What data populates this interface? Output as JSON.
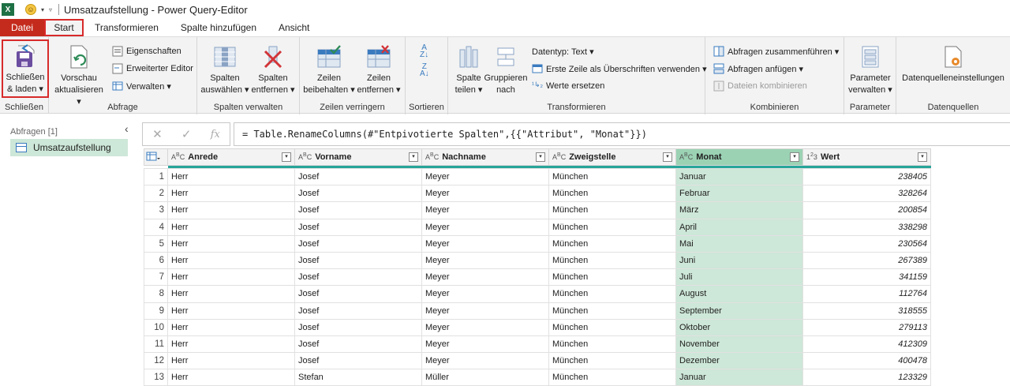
{
  "title": {
    "app_icon": "X",
    "text": "Umsatzaufstellung - Power Query-Editor"
  },
  "tabs": [
    "Datei",
    "Start",
    "Transformieren",
    "Spalte hinzufügen",
    "Ansicht"
  ],
  "ribbon": {
    "schliessen": {
      "btn1": "Schließen",
      "btn2": "& laden",
      "group": "Schließen"
    },
    "abfrage": {
      "vorschau1": "Vorschau",
      "vorschau2": "aktualisieren",
      "eigenschaften": "Eigenschaften",
      "editor": "Erweiterter Editor",
      "verwalten": "Verwalten",
      "group": "Abfrage"
    },
    "spalten": {
      "a1": "Spalten",
      "a2": "auswählen",
      "b1": "Spalten",
      "b2": "entfernen",
      "group": "Spalten verwalten"
    },
    "zeilen": {
      "a1": "Zeilen",
      "a2": "beibehalten",
      "b1": "Zeilen",
      "b2": "entfernen",
      "group": "Zeilen verringern"
    },
    "sortieren": {
      "group": "Sortieren"
    },
    "transformieren": {
      "teilen1": "Spalte",
      "teilen2": "teilen",
      "gruppieren1": "Gruppieren",
      "gruppieren2": "nach",
      "datentyp": "Datentyp: Text",
      "erste_zeile": "Erste Zeile als Überschriften verwenden",
      "werte": "Werte ersetzen",
      "group": "Transformieren"
    },
    "kombinieren": {
      "zusammen": "Abfragen zusammenführen",
      "anfuegen": "Abfragen anfügen",
      "dateien": "Dateien kombinieren",
      "group": "Kombinieren"
    },
    "parameter": {
      "p1": "Parameter",
      "p2": "verwalten",
      "group": "Parameter"
    },
    "datenquellen": {
      "btn": "Datenquelleneinstellungen",
      "group": "Datenquellen"
    }
  },
  "queries": {
    "label": "Abfragen [1]",
    "items": [
      "Umsatzaufstellung"
    ]
  },
  "formula_bar": {
    "cancel": "✕",
    "confirm": "✓",
    "fx": "fx",
    "text": "= Table.RenameColumns(#\"Entpivotierte Spalten\",{{\"Attribut\", \"Monat\"}})"
  },
  "grid": {
    "columns": [
      {
        "type": "ABC",
        "name": "Anrede"
      },
      {
        "type": "ABC",
        "name": "Vorname"
      },
      {
        "type": "ABC",
        "name": "Nachname"
      },
      {
        "type": "ABC",
        "name": "Zweigstelle"
      },
      {
        "type": "ABC",
        "name": "Monat"
      },
      {
        "type": "123",
        "name": "Wert"
      }
    ],
    "rows": [
      [
        "1",
        "Herr",
        "Josef",
        "Meyer",
        "München",
        "Januar",
        "238405"
      ],
      [
        "2",
        "Herr",
        "Josef",
        "Meyer",
        "München",
        "Februar",
        "328264"
      ],
      [
        "3",
        "Herr",
        "Josef",
        "Meyer",
        "München",
        "März",
        "200854"
      ],
      [
        "4",
        "Herr",
        "Josef",
        "Meyer",
        "München",
        "April",
        "338298"
      ],
      [
        "5",
        "Herr",
        "Josef",
        "Meyer",
        "München",
        "Mai",
        "230564"
      ],
      [
        "6",
        "Herr",
        "Josef",
        "Meyer",
        "München",
        "Juni",
        "267389"
      ],
      [
        "7",
        "Herr",
        "Josef",
        "Meyer",
        "München",
        "Juli",
        "341159"
      ],
      [
        "8",
        "Herr",
        "Josef",
        "Meyer",
        "München",
        "August",
        "112764"
      ],
      [
        "9",
        "Herr",
        "Josef",
        "Meyer",
        "München",
        "September",
        "318555"
      ],
      [
        "10",
        "Herr",
        "Josef",
        "Meyer",
        "München",
        "Oktober",
        "279113"
      ],
      [
        "11",
        "Herr",
        "Josef",
        "Meyer",
        "München",
        "November",
        "412309"
      ],
      [
        "12",
        "Herr",
        "Josef",
        "Meyer",
        "München",
        "Dezember",
        "400478"
      ],
      [
        "13",
        "Herr",
        "Stefan",
        "Müller",
        "München",
        "Januar",
        "123329"
      ]
    ]
  }
}
